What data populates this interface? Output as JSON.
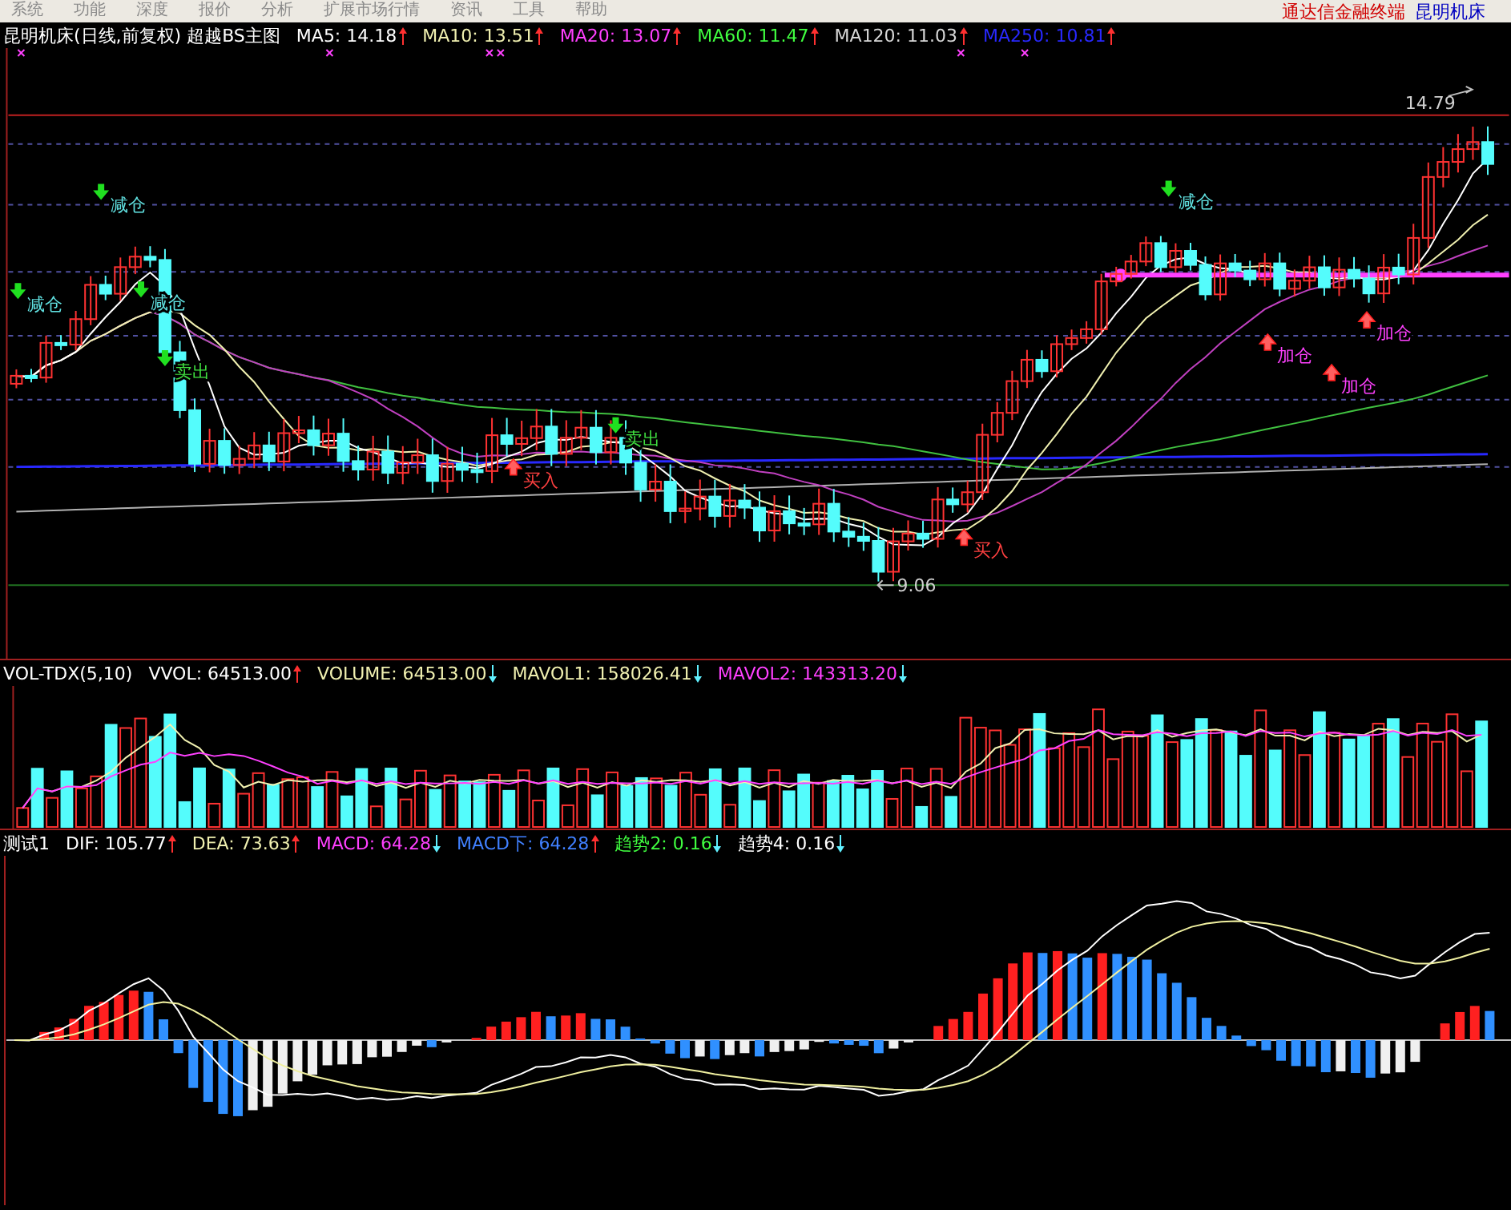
{
  "menu": [
    {
      "label": "系统"
    },
    {
      "label": "功能"
    },
    {
      "label": "深度"
    },
    {
      "label": "报价"
    },
    {
      "label": "分析"
    },
    {
      "label": "扩展市场行情"
    },
    {
      "label": "资讯"
    },
    {
      "label": "工具"
    },
    {
      "label": "帮助"
    }
  ],
  "brand": {
    "app": "通达信金融终端",
    "stock": "昆明机床"
  },
  "main_panel": {
    "title": "昆明机床(日线,前复权) 超越BS主图",
    "indicators": [
      {
        "label": "MA5: 14.18",
        "color": "#ffffff",
        "rising": true
      },
      {
        "label": "MA10: 13.51",
        "color": "#f0f0b0",
        "rising": true
      },
      {
        "label": "MA20: 13.07",
        "color": "#ff40ff",
        "rising": true
      },
      {
        "label": "MA60: 11.47",
        "color": "#40ff40",
        "rising": true
      },
      {
        "label": "MA120: 11.03",
        "color": "#d8d8d8",
        "rising": true
      },
      {
        "label": "MA250: 10.81",
        "color": "#2828ff",
        "rising": true
      }
    ],
    "high_label": "14.79",
    "low_label": "9.06",
    "signals": [
      {
        "kind": "reduce",
        "label": "减仓"
      },
      {
        "kind": "reduce",
        "label": "减仓"
      },
      {
        "kind": "reduce",
        "label": "减仓"
      },
      {
        "kind": "sell",
        "label": "卖出"
      },
      {
        "kind": "buy",
        "label": "买入"
      },
      {
        "kind": "sell",
        "label": "卖出"
      },
      {
        "kind": "buy",
        "label": "买入"
      },
      {
        "kind": "reduce",
        "label": "减仓"
      },
      {
        "kind": "add",
        "label": "加仓"
      },
      {
        "kind": "add",
        "label": "加仓"
      },
      {
        "kind": "add",
        "label": "加仓"
      }
    ]
  },
  "volume_panel": {
    "title": "VOL-TDX(5,10)",
    "indicators": [
      {
        "label": "VVOL: 64513.00",
        "color": "#ffffff",
        "rising": true
      },
      {
        "label": "VOLUME: 64513.00",
        "color": "#f0f0b0",
        "rising": false
      },
      {
        "label": "MAVOL1: 158026.41",
        "color": "#f0f0b0",
        "rising": false
      },
      {
        "label": "MAVOL2: 143313.20",
        "color": "#ff40ff",
        "rising": false
      }
    ]
  },
  "macd_panel": {
    "title": "测试1",
    "indicators": [
      {
        "label": "DIF: 105.77",
        "color": "#ffffff",
        "rising": true
      },
      {
        "label": "DEA: 73.63",
        "color": "#f0f0b0",
        "rising": true
      },
      {
        "label": "MACD: 64.28",
        "color": "#ff40ff",
        "rising": false
      },
      {
        "label": "MACD下: 64.28",
        "color": "#4080ff",
        "rising": true
      },
      {
        "label": "趋势2: 0.16",
        "color": "#40ff40",
        "rising": false
      },
      {
        "label": "趋势4: 0.16",
        "color": "#ffffff",
        "rising": false
      }
    ]
  }
}
